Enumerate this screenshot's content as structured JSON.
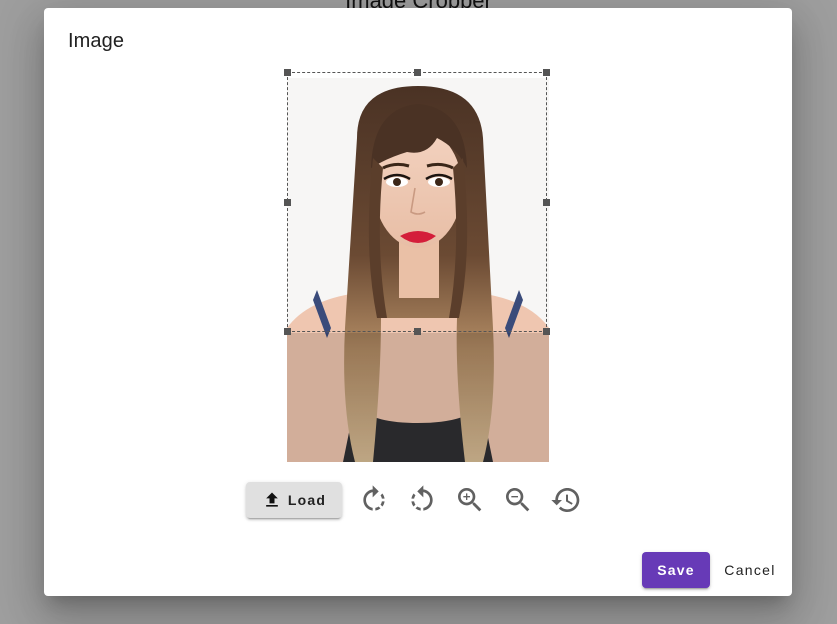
{
  "backdrop": {
    "title": "Image Cropper"
  },
  "dialog": {
    "title": "Image"
  },
  "toolbar": {
    "load_label": "Load",
    "icons": [
      "upload-icon",
      "rotate-right-icon",
      "rotate-left-icon",
      "zoom-in-icon",
      "zoom-out-icon",
      "history-icon"
    ]
  },
  "actions": {
    "save_label": "Save",
    "cancel_label": "Cancel"
  },
  "colors": {
    "primary": "#673ab7",
    "backdrop": "#9e9e9e",
    "load_button": "#e0e0e0",
    "icon": "#616161"
  }
}
